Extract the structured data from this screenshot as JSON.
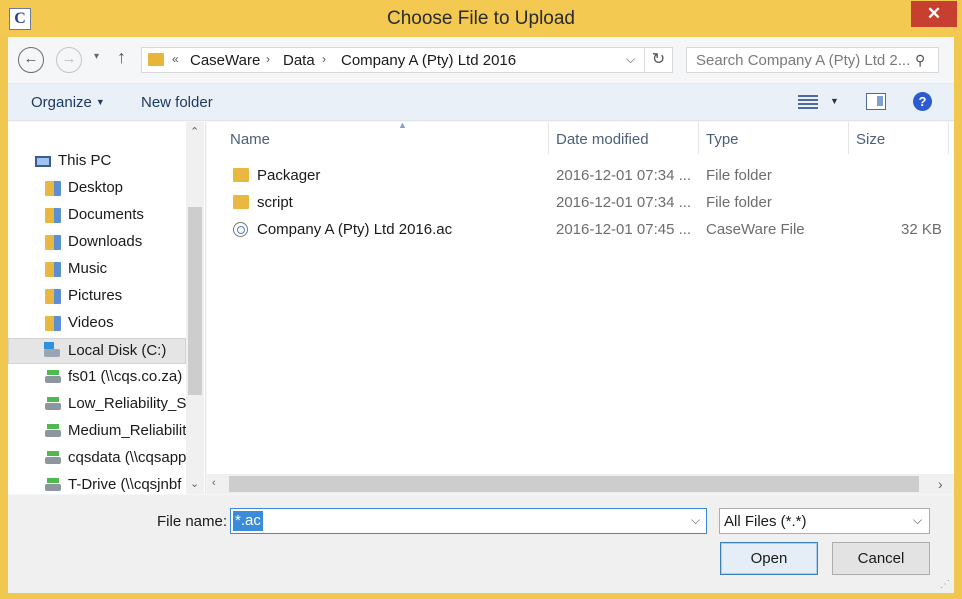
{
  "window": {
    "title": "Choose File to Upload",
    "app_icon_letter": "C",
    "close_glyph": "✕"
  },
  "nav": {
    "back_glyph": "←",
    "forward_glyph": "→",
    "up_glyph": "↑",
    "dropdown_glyph": "▾"
  },
  "address": {
    "overflow": "«",
    "parts": [
      "CaseWare",
      "Data",
      "Company A (Pty) Ltd 2016"
    ],
    "separator": "›",
    "dropdown_glyph": "⌵",
    "refresh_glyph": "↻"
  },
  "search": {
    "placeholder": "Search Company A (Pty) Ltd 2...",
    "icon_glyph": "⚲"
  },
  "toolbar": {
    "organize_label": "Organize",
    "new_folder_label": "New folder",
    "help_glyph": "?"
  },
  "sidebar": {
    "items": [
      {
        "label": "This PC",
        "icon": "computer-icon"
      },
      {
        "label": "Desktop",
        "icon": "desktop-folder-icon"
      },
      {
        "label": "Documents",
        "icon": "documents-folder-icon"
      },
      {
        "label": "Downloads",
        "icon": "downloads-folder-icon"
      },
      {
        "label": "Music",
        "icon": "music-folder-icon"
      },
      {
        "label": "Pictures",
        "icon": "pictures-folder-icon"
      },
      {
        "label": "Videos",
        "icon": "videos-folder-icon"
      },
      {
        "label": "Local Disk (C:)",
        "icon": "local-disk-icon",
        "selected": true
      },
      {
        "label": "fs01 (\\\\cqs.co.za)",
        "icon": "network-drive-icon"
      },
      {
        "label": "Low_Reliability_St",
        "icon": "network-drive-icon"
      },
      {
        "label": "Medium_Reliabilit",
        "icon": "network-drive-icon"
      },
      {
        "label": "cqsdata (\\\\cqsapp",
        "icon": "network-drive-icon"
      },
      {
        "label": "T-Drive (\\\\cqsjnbf",
        "icon": "network-drive-icon"
      }
    ]
  },
  "file_list": {
    "columns": [
      "Name",
      "Date modified",
      "Type",
      "Size"
    ],
    "rows": [
      {
        "name": "Packager",
        "date": "2016-12-01 07:34 ...",
        "type": "File folder",
        "size": "",
        "icon": "folder-icon"
      },
      {
        "name": "script",
        "date": "2016-12-01 07:34 ...",
        "type": "File folder",
        "size": "",
        "icon": "folder-icon"
      },
      {
        "name": "Company A (Pty) Ltd 2016.ac",
        "date": "2016-12-01 07:45 ...",
        "type": "CaseWare File",
        "size": "32 KB",
        "icon": "caseware-file-icon"
      }
    ]
  },
  "bottom": {
    "file_name_label": "File name:",
    "file_name_value": "*.ac",
    "file_type_value": "All Files (*.*)",
    "open_label": "Open",
    "cancel_label": "Cancel"
  }
}
